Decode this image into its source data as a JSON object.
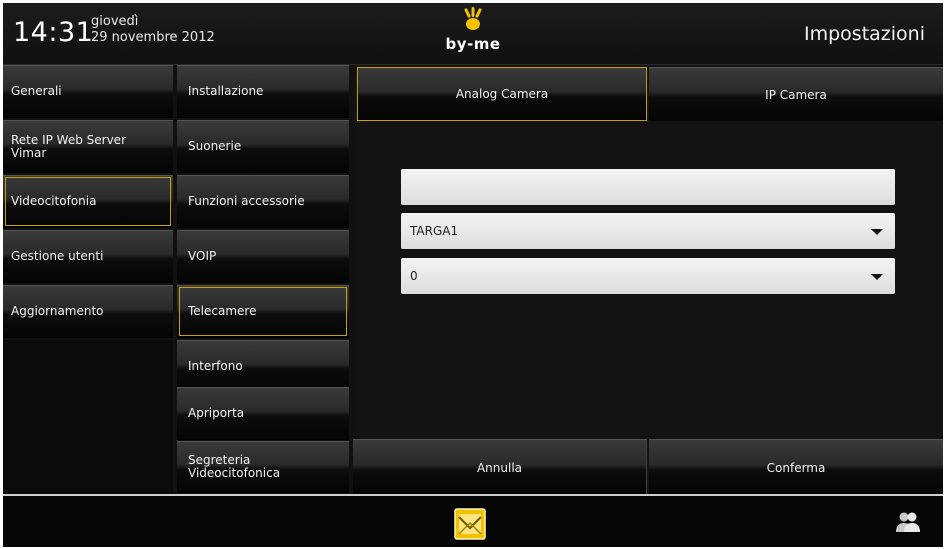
{
  "header": {
    "time": "14:31",
    "day": "giovedì",
    "date": "29 novembre 2012",
    "logo_text": "by-me",
    "title": "Impostazioni"
  },
  "menu": {
    "items": [
      {
        "label": "Generali"
      },
      {
        "label": "Rete IP Web Server Vimar"
      },
      {
        "label": "Videocitofonia",
        "selected": true
      },
      {
        "label": "Gestione utenti"
      },
      {
        "label": "Aggiornamento"
      }
    ]
  },
  "submenu": {
    "items": [
      {
        "label": "Installazione"
      },
      {
        "label": "Suonerie"
      },
      {
        "label": "Funzioni accessorie"
      },
      {
        "label": "VOIP"
      },
      {
        "label": "Telecamere",
        "selected": true
      },
      {
        "label": "Interfono"
      },
      {
        "label": "Apriporta"
      },
      {
        "label": "Segreteria Videocitofonica"
      }
    ]
  },
  "panel": {
    "tabs": [
      {
        "label": "Analog Camera",
        "selected": true
      },
      {
        "label": "IP Camera"
      }
    ],
    "name_input": {
      "value": "",
      "placeholder": ""
    },
    "targa_select": {
      "value": "TARGA1"
    },
    "number_select": {
      "value": "0"
    },
    "cancel_label": "Annulla",
    "confirm_label": "Conferma"
  },
  "colors": {
    "accent": "#c8a000",
    "background": "#111111"
  },
  "footer": {
    "home_icon": "home-icon",
    "users_icon": "users-icon"
  }
}
